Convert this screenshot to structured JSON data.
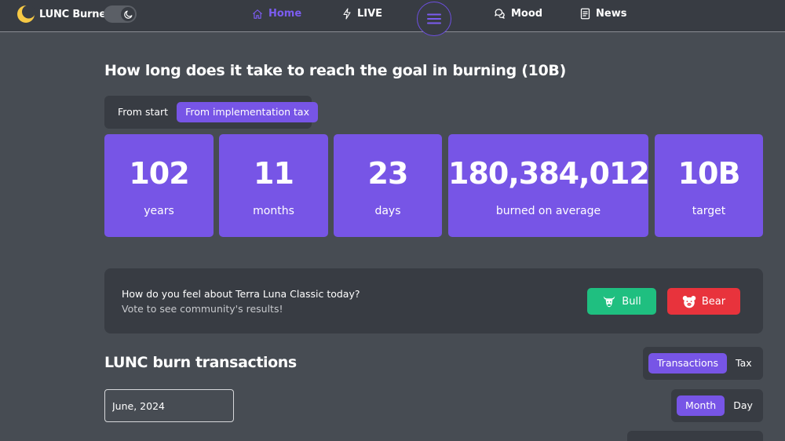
{
  "brand": {
    "name": "LUNC Burner"
  },
  "nav": {
    "home": "Home",
    "live": "LIVE",
    "mood": "Mood",
    "news": "News"
  },
  "colors": {
    "accent": "#7755e6",
    "background": "#474c53",
    "panel": "#383c43",
    "bull": "#1fbf80",
    "bear": "#e8333c",
    "brand_moon": "#f6c945"
  },
  "goal": {
    "headline": "How long does it take to reach the goal in burning (10B)",
    "toggle": [
      "From start",
      "From implementation tax"
    ],
    "active_toggle": "From implementation tax",
    "stats": [
      {
        "value": "102",
        "label": "years"
      },
      {
        "value": "11",
        "label": "months"
      },
      {
        "value": "23",
        "label": "days"
      },
      {
        "value": "180,384,012",
        "label": "burned on average"
      },
      {
        "value": "10B",
        "label": "target"
      }
    ]
  },
  "vote": {
    "question": "How do you feel about Terra Luna Classic today?",
    "hint": "Vote to see community's results!",
    "bull": "Bull",
    "bear": "Bear",
    "bull_icon": "bull-head-icon",
    "bear_icon": "bear-head-icon"
  },
  "transactions": {
    "title": "LUNC burn transactions",
    "type_toggle": [
      "Transactions",
      "Tax"
    ],
    "active_type": "Transactions",
    "period_toggle": [
      "Month",
      "Day"
    ],
    "active_period": "Month",
    "date_value": "June, 2024"
  }
}
